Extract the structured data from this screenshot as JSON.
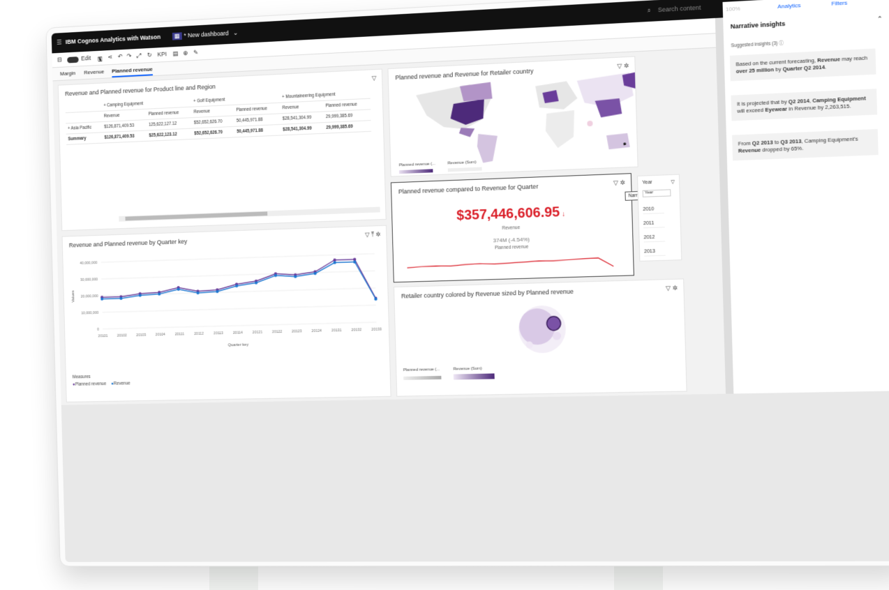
{
  "app": {
    "title": "IBM Cognos Analytics with Watson",
    "dashboard_name": "* New dashboard",
    "search_placeholder": "Search content",
    "zoom": "100%",
    "analytics_label": "Analytics",
    "filters_label": "Filters"
  },
  "toolbar": {
    "edit_label": "Edit",
    "kpi_label": "KPI"
  },
  "tabs": [
    {
      "label": "Margin"
    },
    {
      "label": "Revenue"
    },
    {
      "label": "Planned revenue"
    }
  ],
  "crosstab": {
    "title": "Revenue and Planned revenue for Product line and Region",
    "groups": [
      "+ Camping Equipment",
      "+ Golf Equipment",
      "+ Mountaineering Equipment"
    ],
    "measures": [
      "Revenue",
      "Planned revenue",
      "Revenue",
      "Planned revenue",
      "Revenue",
      "Planned revenue"
    ],
    "rows": [
      {
        "label": "+ Asia Pacific",
        "values": [
          "$126,871,409.53",
          "125,622,127.12",
          "$52,652,626.70",
          "50,445,971.88",
          "$28,541,304.99",
          "29,999,385.69"
        ]
      },
      {
        "label": "Summary",
        "values": [
          "$126,871,409.53",
          "$25,622,123.12",
          "$52,652,626.70",
          "50,445,971.88",
          "$28,541,304.99",
          "29,999,385.69"
        ]
      }
    ]
  },
  "line_chart": {
    "title": "Revenue and Planned revenue by Quarter key",
    "legend_title": "Measures",
    "xlabel_text": "Quarter key",
    "ylabel_text": "Values",
    "series_names": [
      "Planned revenue",
      "Revenue"
    ]
  },
  "chart_data": {
    "type": "line",
    "title": "Revenue and Planned revenue by Quarter key",
    "xlabel": "Quarter key",
    "ylabel": "Values",
    "x": [
      "20101",
      "20102",
      "20103",
      "20104",
      "20111",
      "20112",
      "20113",
      "20114",
      "20121",
      "20122",
      "20123",
      "20124",
      "20131",
      "20132",
      "20133"
    ],
    "ylim": [
      0,
      40000000
    ],
    "yticks": [
      "40,000,000",
      "30,000,000",
      "20,000,000",
      "10,000,000",
      "0"
    ],
    "series": [
      {
        "name": "Planned revenue",
        "color": "#6a3d9a",
        "values": [
          19000000,
          19000000,
          20500000,
          21000000,
          23500000,
          21000000,
          21500000,
          24500000,
          26000000,
          30000000,
          29000000,
          30500000,
          37000000,
          37000000,
          14000000
        ]
      },
      {
        "name": "Revenue",
        "color": "#1f78d1",
        "values": [
          18000000,
          18000000,
          19500000,
          20000000,
          22500000,
          20000000,
          20500000,
          23500000,
          25000000,
          29000000,
          28000000,
          29500000,
          35500000,
          35500000,
          13500000
        ]
      }
    ]
  },
  "map": {
    "title": "Planned revenue and Revenue for Retailer country",
    "legend_planned": "Planned revenue (...",
    "legend_revenue": "Revenue (Sum)"
  },
  "kpi": {
    "title": "Planned revenue compared to Revenue for Quarter",
    "value": "$357,446,606.95",
    "value_label": "Revenue",
    "comparison": "374M (-4.54%)",
    "comparison_label": "Planned revenue",
    "trend": [
      0.55,
      0.5,
      0.48,
      0.52,
      0.45,
      0.42,
      0.47,
      0.44,
      0.4,
      0.36,
      0.38,
      0.34,
      0.3,
      0.28,
      0.85
    ]
  },
  "tooltip": "Narrative insights",
  "year_filter": {
    "title": "Year",
    "header": "Year",
    "years": [
      "2010",
      "2011",
      "2012",
      "2013"
    ]
  },
  "bubble": {
    "title": "Retailer country colored by Revenue sized by Planned revenue",
    "legend_planned": "Planned revenue (...",
    "legend_revenue": "Revenue (Sum)"
  },
  "narrative": {
    "title": "Narrative insights",
    "subtitle": "Suggested insights (3)",
    "insights": [
      {
        "pre": "Based on the current forecasting, ",
        "b1": "Revenue",
        "mid": " may reach ",
        "b2": "over 25 million",
        "mid2": " by ",
        "b3": "Quarter Q2 2014",
        "post": "."
      },
      {
        "pre": "It is projected that by ",
        "b1": "Q2 2014",
        "mid": ", ",
        "b2": "Camping Equipment",
        "mid2": " will exceed ",
        "b3": "Eyewear",
        "post": " in Revenue by 2,263,515."
      },
      {
        "pre": "From ",
        "b1": "Q2 2013",
        "mid": " to ",
        "b2": "Q3 2013",
        "mid2": ", Camping Equipment's ",
        "b3": "Revenue",
        "post": " dropped by 65%."
      }
    ]
  },
  "colors": {
    "accent": "#0f62fe",
    "kpi_red": "#da1e28",
    "purple": "#6a3d9a",
    "blue": "#1f78d1"
  }
}
